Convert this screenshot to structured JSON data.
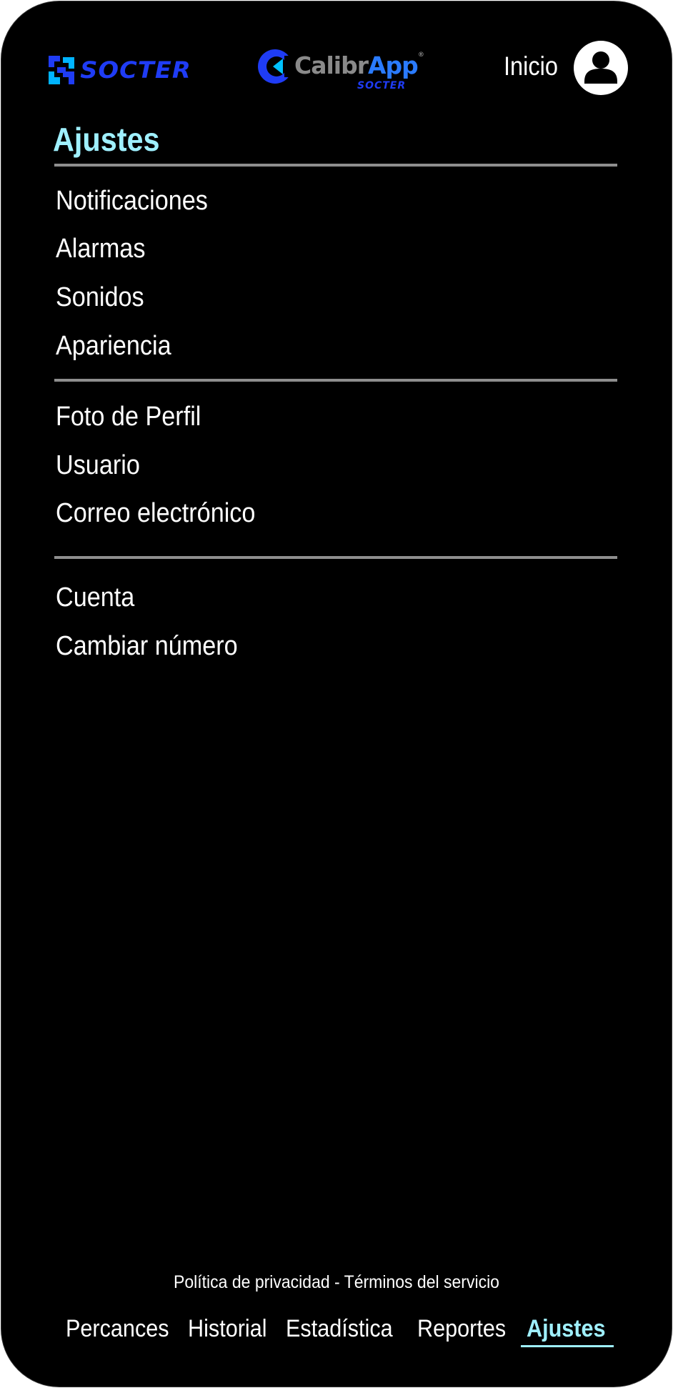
{
  "header": {
    "brand_left": "SOCTER",
    "brand_app_main_1": "Calibr",
    "brand_app_main_2": "App",
    "brand_app_mark": "®",
    "brand_app_sub": "SOCTER",
    "home_link": "Inicio",
    "avatar_icon": "user-icon"
  },
  "page": {
    "title": "Ajustes"
  },
  "menu": {
    "group1": [
      "Notificaciones",
      "Alarmas",
      "Sonidos",
      "Apariencia"
    ],
    "group2": [
      "Foto de Perfil",
      "Usuario",
      "Correo electrónico"
    ],
    "group3": [
      "Cuenta",
      "Cambiar número"
    ]
  },
  "footer": {
    "privacy": "Política de privacidad",
    "separator": " - ",
    "terms": "Términos del servicio"
  },
  "nav": {
    "tabs": [
      "Percances",
      "Historial",
      "Estadística",
      "Reportes",
      "Ajustes"
    ],
    "active": "Ajustes"
  },
  "colors": {
    "background": "#000000",
    "accent": "#9ff0ff",
    "brand_blue": "#1f3cf5",
    "divider": "#8e8e8e"
  }
}
